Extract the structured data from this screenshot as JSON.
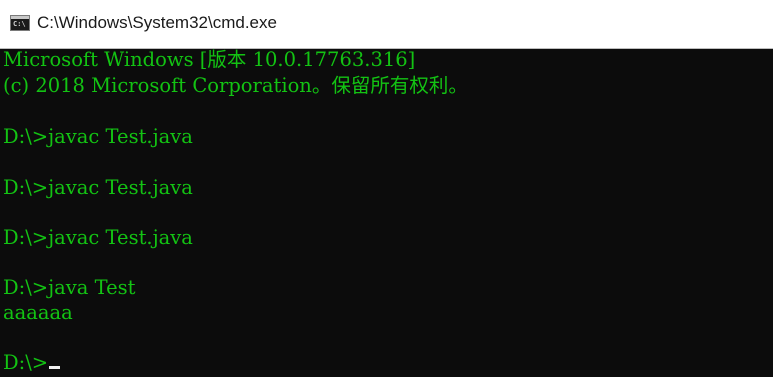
{
  "window": {
    "title": "C:\\Windows\\System32\\cmd.exe",
    "icon": "cmd-icon",
    "icon_text": "C:\\",
    "console_bg": "#0c0c0c",
    "console_fg": "#13c313"
  },
  "console": {
    "lines": [
      "Microsoft Windows [版本 10.0.17763.316]",
      "(c) 2018 Microsoft Corporation。保留所有权利。",
      "D:\\>javac Test.java",
      "D:\\>javac Test.java",
      "D:\\>javac Test.java",
      "D:\\>java Test",
      "aaaaaa",
      "D:\\>"
    ]
  }
}
